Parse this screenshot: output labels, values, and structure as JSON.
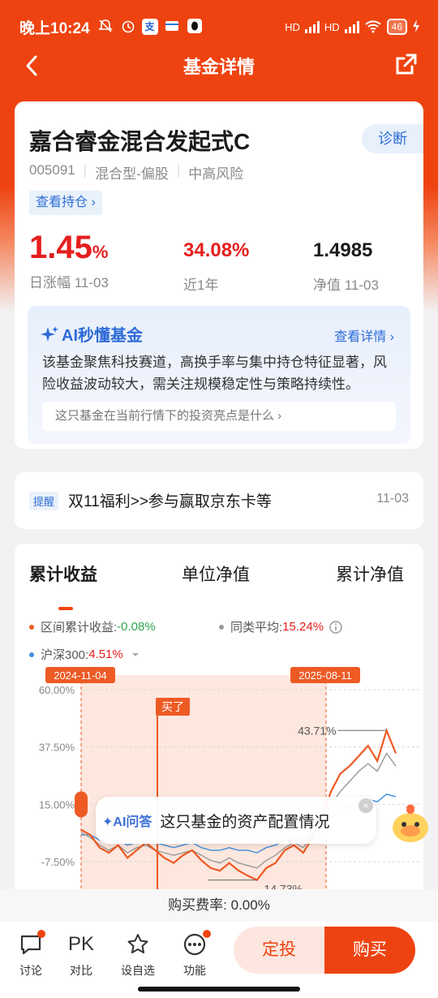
{
  "status_bar": {
    "time": "晚上10:24",
    "network": "HD",
    "battery": "46"
  },
  "nav": {
    "title": "基金详情"
  },
  "fund": {
    "name": "嘉合睿金混合发起式C",
    "diagnose_label": "诊断",
    "code": "005091",
    "type": "混合型-偏股",
    "risk": "中高风险",
    "holdings_link": "查看持仓 ›",
    "daily_change": "1.45",
    "daily_change_unit": "%",
    "daily_change_label": "日涨幅 11-03",
    "one_year": "34.08%",
    "one_year_label": "近1年",
    "nav_value": "1.4985",
    "nav_label": "净值 11-03"
  },
  "ai_insight": {
    "title": "AI秒懂基金",
    "more": "查看详情 ›",
    "text": "该基金聚焦科技赛道，高换手率与集中持仓特征显著，风险收益波动较大，需关注规模稳定性与策略持续性。",
    "question": "这只基金在当前行情下的投资亮点是什么 ›"
  },
  "notice": {
    "tag": "提醒",
    "text": "双11福利>>参与赢取京东卡等",
    "date": "11-03"
  },
  "chart_tabs": [
    "累计收益",
    "单位净值",
    "累计净值"
  ],
  "legend": {
    "interval_label": "区间累计收益:",
    "interval_value": "-0.08%",
    "peer_label": "同类平均:",
    "peer_value": "15.24%",
    "index_label": "沪深300:",
    "index_value": "4.51%"
  },
  "chart_data": {
    "type": "line",
    "y_ticks": [
      "60.00%",
      "37.50%",
      "15.00%",
      "-7.50%"
    ],
    "ylim": [
      -7.5,
      60
    ],
    "range_start": "2024-11-04",
    "range_end": "2025-08-11",
    "buy_marker": "买了",
    "annotations": [
      "43.71%",
      "-14.73%"
    ],
    "series": [
      {
        "name": "区间累计收益",
        "color": "#ee5a24",
        "values": [
          5,
          3,
          -2,
          -4,
          -1,
          -6,
          -3,
          0,
          -3,
          -6,
          -8,
          -5,
          -3,
          -7,
          -10,
          -11,
          -8,
          -11,
          -13,
          -14.7,
          -10,
          -8,
          -3,
          -1,
          -4,
          2,
          10,
          20,
          27,
          30,
          34,
          38,
          32,
          44,
          35
        ]
      },
      {
        "name": "同类平均",
        "color": "#999999",
        "values": [
          4,
          2,
          -1,
          -3,
          -1,
          -4,
          -2,
          -1,
          -3,
          -4,
          -5,
          -4,
          -3,
          -5,
          -7,
          -8,
          -6,
          -8,
          -9,
          -10,
          -7,
          -5,
          -2,
          0,
          -2,
          3,
          9,
          15,
          20,
          24,
          28,
          31,
          28,
          35,
          30
        ]
      },
      {
        "name": "沪深300",
        "color": "#3e8fe0",
        "values": [
          3,
          3,
          1,
          0,
          1,
          -1,
          0,
          1,
          0,
          -1,
          -2,
          -1,
          0,
          -2,
          -3,
          -3,
          -2,
          -3,
          -3,
          -4,
          -2,
          -1,
          1,
          2,
          1,
          4,
          7,
          10,
          12,
          14,
          16,
          17,
          16,
          19,
          18
        ]
      }
    ]
  },
  "ai_bubble": {
    "label": "✦AI问答",
    "question": "这只基金的资产配置情况"
  },
  "fee": {
    "text": "购买费率: 0.00%"
  },
  "bottom_bar": {
    "discuss": "讨论",
    "compare_icon": "PK",
    "compare": "对比",
    "watch": "设自选",
    "functions": "功能",
    "sip": "定投",
    "buy": "购买"
  },
  "colors": {
    "brand": "#ee4311",
    "rise": "#e61e1e",
    "fall": "#2ea44f",
    "link": "#2e6fd4"
  }
}
